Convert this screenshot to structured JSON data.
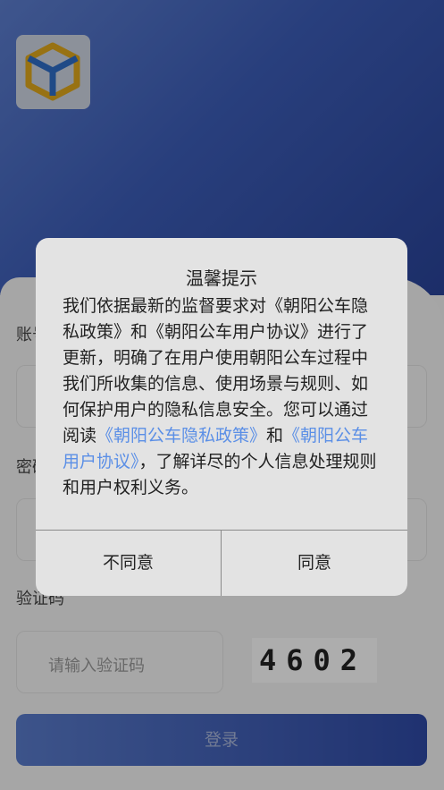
{
  "app": {
    "logo_icon": "cube-logo-icon"
  },
  "form": {
    "account_label": "账号",
    "password_label": "密码",
    "code_label": "验证码",
    "code_placeholder": "请输入验证码",
    "captcha_text": "4602",
    "login_label": "登录"
  },
  "dialog": {
    "title": "温馨提示",
    "body_part1": "我们依据最新的监督要求对《朝阳公车隐私政策》和《朝阳公车用户协议》进行了更新，明确了在用户使用朝阳公车过程中我们所收集的信息、使用场景与规则、如何保护用户的隐私信息安全。您可以通过阅读",
    "privacy_link": "《朝阳公车隐私政策》",
    "body_and": "和",
    "agreement_link": "《朝阳公车用户协议》",
    "body_part2": "，了解详尽的个人信息处理规则和用户权利义务。",
    "disagree_label": "不同意",
    "agree_label": "同意"
  },
  "colors": {
    "header_blue": "#3c5db8",
    "link_blue": "#5b8fe6",
    "logo_yellow": "#e1a81c",
    "logo_blue": "#2f6ec8"
  }
}
